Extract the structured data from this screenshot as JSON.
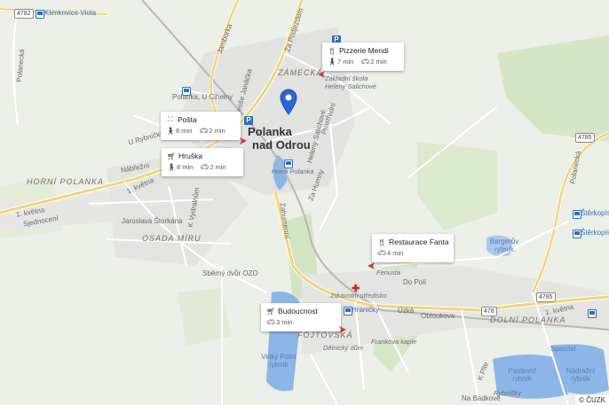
{
  "map": {
    "copyright": "© ČUZK",
    "pin_icon": "location-pin-icon"
  },
  "labels": {
    "town_line1": "Polanka",
    "town_line2": "nad Odrou",
    "zamecka": "ZÁMECKÁ",
    "horni_polanka": "HORNÍ POLANKA",
    "osada_miru": "OSADA MÍRU",
    "fojtovska": "FOJTOVSKÁ",
    "dolni_polanka": "DOLNÍ POLANKA",
    "polanecka": "Polanecká",
    "jamborka": "Jamborka",
    "za_podjezdem": "Za Podjezdem",
    "polanka_u_cihelny": "Polanka, U Cihelny",
    "leose_janacka": "Leoše Janáčka",
    "u_rybnicku": "U Rybníčku",
    "nabrezni": "Nábřežní",
    "cerveneho_kvetna": "1. května",
    "sjednoceni": "Sjednocení",
    "jaroslava_storkana": "Jaroslava Štorkána",
    "k_vydralnum": "K Vydralnům",
    "zahumenni": "Zahumenní",
    "sberny_dvur": "Sběrný dvůr OZO",
    "helen_salichove": "Heleny Salichové",
    "prostredni": "Prostřední",
    "za_humny": "Za Humny",
    "horni_polanka_stop": "Horní Polanka",
    "zakladni_skola": "Základní škola Heleny Salichové",
    "fenusta": "Fenusta",
    "zdravotni_stredisko": "Zdravotní středisko",
    "do_poli": "Do Polí",
    "uzka": "Úzká",
    "obloukova": "Obloukova",
    "hranicky": "Hraničky",
    "frankova_kaple": "Frankova kaple",
    "delnicky_dum": "Dělnický dům",
    "velky_polni_rybnik": "Velký Polní rybník",
    "pastevni_rybnik": "Pastevní rybník",
    "nadrazni_rybnik": "Nádražní rybník",
    "na_badkove": "Na Badkově",
    "rybnicky": "Rybníčky",
    "spasitel": "Spasitel",
    "bargeruv_rybnik": "Bargerův rybník",
    "sterkopisek1": "Štěrkopísek",
    "sterkopisek2": "Štěrkopísek",
    "klimkovice_viola": "Klimkovice Viola",
    "polanecka_east": "Polanecká",
    "cerveneho_kvetna_east": "1. května",
    "k_plte": "K Plte"
  },
  "shields": {
    "r4782": "4782",
    "r4785a": "4785",
    "r4785b": "4785",
    "r478": "478"
  },
  "cards": [
    {
      "name": "Pizzerie Mendi",
      "icon": "restaurant-icon",
      "walk": "7 min",
      "car": "2 min"
    },
    {
      "name": "Pošta",
      "icon": "post-office-icon",
      "walk": "8 min",
      "car": "2 min"
    },
    {
      "name": "Hruška",
      "icon": "shopping-cart-icon",
      "walk": "8 min",
      "car": "2 min"
    },
    {
      "name": "Restaurace Fanta...",
      "icon": "restaurant-icon",
      "walk": "",
      "car": "4 min"
    },
    {
      "name": "Budoucnost",
      "icon": "shopping-cart-icon",
      "walk": "",
      "car": "3 min"
    }
  ]
}
